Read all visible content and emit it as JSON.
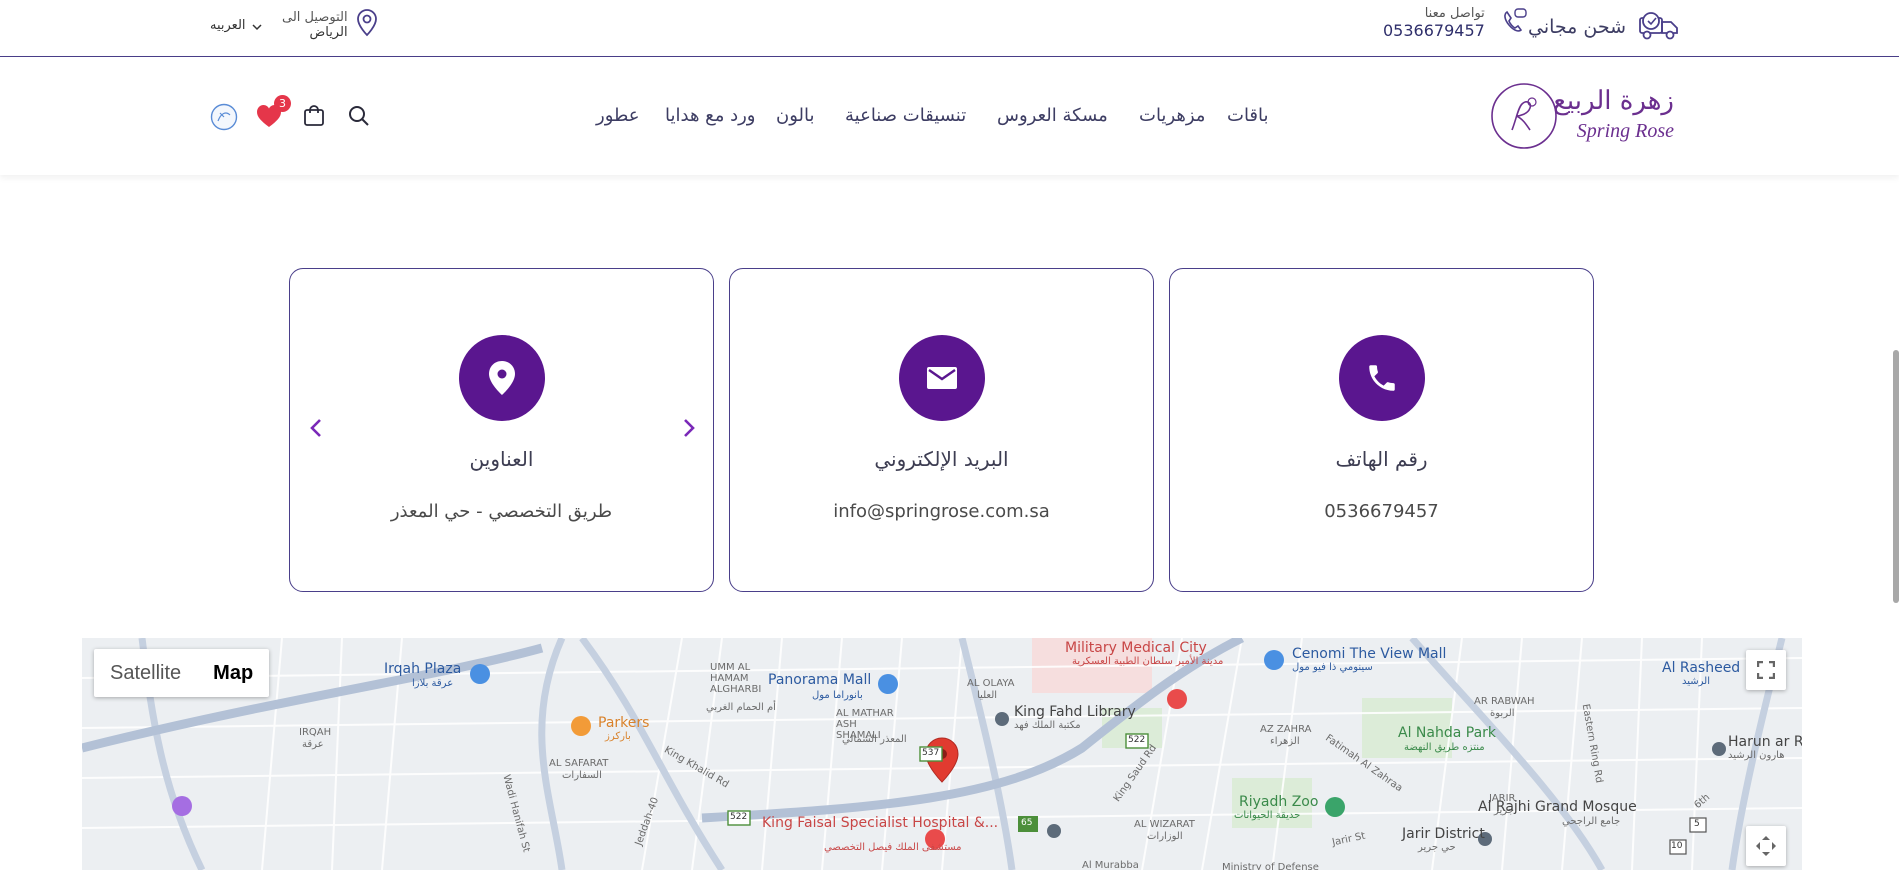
{
  "topbar": {
    "free_shipping": "شحن مجاني",
    "contact_label": "تواصل معنا",
    "contact_phone": "0536679457",
    "delivery_label": "التوصيل الى",
    "delivery_city": "الرياض",
    "language": "العربيه"
  },
  "header": {
    "logo_ar": "زهرة الربيع",
    "logo_en": "Spring Rose",
    "nav": [
      "باقات",
      "مزهريات",
      "مسكة العروس",
      "تنسيقات صناعية",
      "بالون",
      "ورد مع هدايا",
      "عطور"
    ],
    "wishlist_count": "3"
  },
  "contact_cards": [
    {
      "icon": "phone-icon",
      "title": "رقم الهاتف",
      "value": "0536679457"
    },
    {
      "icon": "email-icon",
      "title": "البريد الإلكتروني",
      "value": "info@springrose.com.sa"
    },
    {
      "icon": "location-pin-icon",
      "title": "العناوين",
      "value": "طريق التخصصي - حي المعذر"
    }
  ],
  "map": {
    "toggle_satellite": "Satellite",
    "toggle_map": "Map",
    "labels": {
      "military_en": "Military Medical City",
      "military_ar": "مدينة الأمير سلطان الطبية العسكرية",
      "cenomi_en": "Cenomi The View Mall",
      "cenomi_ar": "سينومي ذا فيو مول",
      "rasheed_en": "Al Rasheed M",
      "rasheed_ar": "الرشيد",
      "irqah_en": "Irqah Plaza",
      "irqah_ar": "عرقة بلازا",
      "panorama_en": "Panorama Mall",
      "panorama_ar": "بانوراما مول",
      "olaya_en": "AL OLAYA",
      "olaya_ar": "العليا",
      "fahd_lib_en": "King Fahd Library",
      "fahd_lib_ar": "مكتبة الملك فهد",
      "parkers_en": "Parkers",
      "parkers_ar": "باركرز",
      "um_hamam": "UMM AL HAMAM ALGHARBI",
      "um_hamam_ar": "أم الحمام الغربي",
      "mathar": "AL MATHAR ASH SHAMALI",
      "mathar_ar": "المعذر الشمالي",
      "irqah_area": "IRQAH",
      "irqah_area_ar": "عرقة",
      "safarat": "AL SAFARAT",
      "safarat_ar": "السفارات",
      "azzahra": "AZ ZAHRA",
      "azzahra_ar": "الزهراء",
      "rabwah": "AR RABWAH",
      "rabwah_ar": "الربوة",
      "nahda_en": "Al Nahda Park",
      "nahda_ar": "منتزه طريق النهضة",
      "harun_en": "Harun ar Ra",
      "harun_ar": "هارون الرشيد",
      "zoo_en": "Riyadh Zoo",
      "zoo_ar": "حديقة الحيوانات",
      "jarir_area": "JARIR",
      "jarir_area_ar": "جرير",
      "rajhi_en": "Al Rajhi Grand Mosque",
      "rajhi_ar": "جامع الراجحي",
      "wizarat": "AL WIZARAT",
      "wizarat_ar": "الوزارات",
      "jarir_district": "Jarir District",
      "jarir_district_ar": "حي جرير",
      "jarir_st": "Jarir St",
      "fatimah": "Fatimah Al Zahraa",
      "king_saud": "King Saud Rd",
      "king_khalid": "King Khalid Rd",
      "wadi_hanifah": "Wadi Hanifah St",
      "jeddah": "Jeddah-40",
      "eastern_ring": "Eastern Ring Rd",
      "sixth": "6th",
      "murabba": "Al Murabba",
      "ministry": "Ministry of Defense",
      "kfsh_en": "King Faisal Specialist Hospital &...",
      "kfsh_ar": "مستشفى الملك فيصل التخصصي",
      "r537": "537",
      "r522a": "522",
      "r522b": "522",
      "r65": "65",
      "r5": "5",
      "r10": "10"
    }
  },
  "colors": {
    "brand_purple": "#5a168f",
    "border_purple": "#4a3f8a",
    "badge_red": "#e5364a",
    "map_red_label": "#d93f3f"
  }
}
